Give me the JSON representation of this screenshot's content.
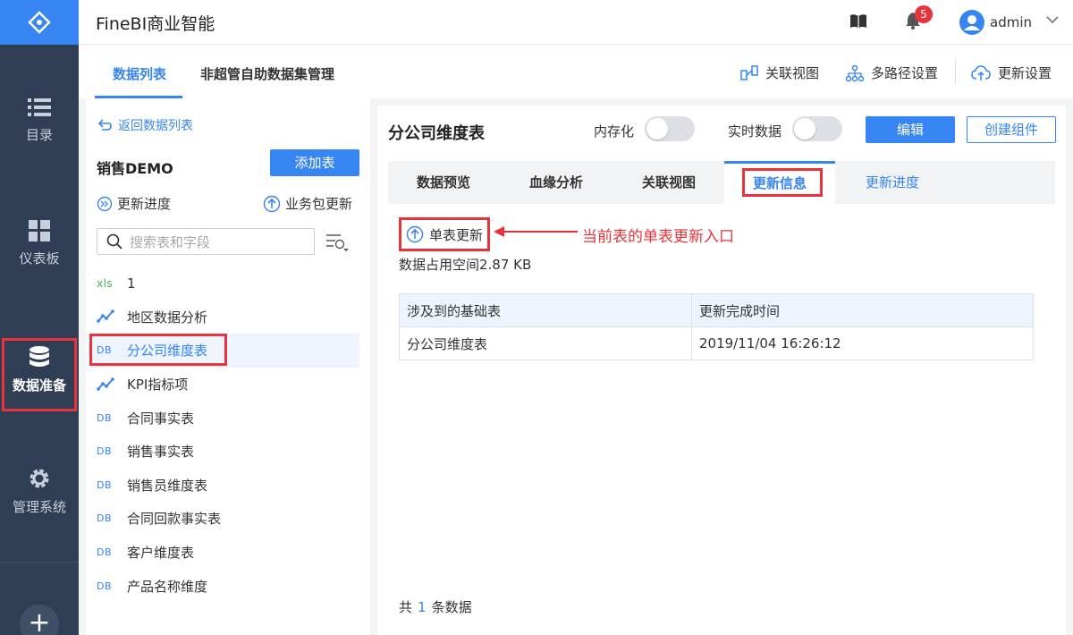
{
  "app": {
    "title": "FineBI商业智能",
    "user": "admin",
    "notification_count": "5"
  },
  "nav": {
    "items": [
      {
        "label": "目录",
        "icon": "list-icon"
      },
      {
        "label": "仪表板",
        "icon": "dashboard-icon"
      },
      {
        "label": "数据准备",
        "icon": "database-icon",
        "active": true
      },
      {
        "label": "管理系统",
        "icon": "gear-icon"
      }
    ],
    "add": "+"
  },
  "topbar": {
    "tabs": [
      "数据列表",
      "非超管自助数据集管理"
    ],
    "tools": [
      "关联视图",
      "多路径设置",
      "更新设置"
    ]
  },
  "left": {
    "back": "返回数据列表",
    "package": "销售DEMO",
    "add_table": "添加表",
    "update_progress": "更新进度",
    "package_update": "业务包更新",
    "search_placeholder": "搜索表和字段",
    "tables": [
      {
        "type": "xls",
        "name": "1"
      },
      {
        "type": "analysis",
        "name": "地区数据分析"
      },
      {
        "type": "DB",
        "name": "分公司维度表",
        "selected": true
      },
      {
        "type": "analysis",
        "name": "KPI指标项"
      },
      {
        "type": "DB",
        "name": "合同事实表"
      },
      {
        "type": "DB",
        "name": "销售事实表"
      },
      {
        "type": "DB",
        "name": "销售员维度表"
      },
      {
        "type": "DB",
        "name": "合同回款事实表"
      },
      {
        "type": "DB",
        "name": "客户维度表"
      },
      {
        "type": "DB",
        "name": "产品名称维度"
      }
    ]
  },
  "right": {
    "title": "分公司维度表",
    "in_memory_label": "内存化",
    "realtime_label": "实时数据",
    "edit": "编辑",
    "create_component": "创建组件",
    "subtabs": [
      "数据预览",
      "血缘分析",
      "关联视图",
      "更新信息",
      "更新进度"
    ],
    "single_update": "单表更新",
    "annotation": "当前表的单表更新入口",
    "space_used": "数据占用空间2.87 KB",
    "table": {
      "headers": [
        "涉及到的基础表",
        "更新完成时间"
      ],
      "rows": [
        [
          "分公司维度表",
          "2019/11/04 16:26:12"
        ]
      ]
    },
    "footer_prefix": "共",
    "footer_count": "1",
    "footer_suffix": "条数据"
  },
  "colors": {
    "accent": "#3685f2",
    "highlight": "#e8333a",
    "nav_bg": "#2f3e54"
  }
}
